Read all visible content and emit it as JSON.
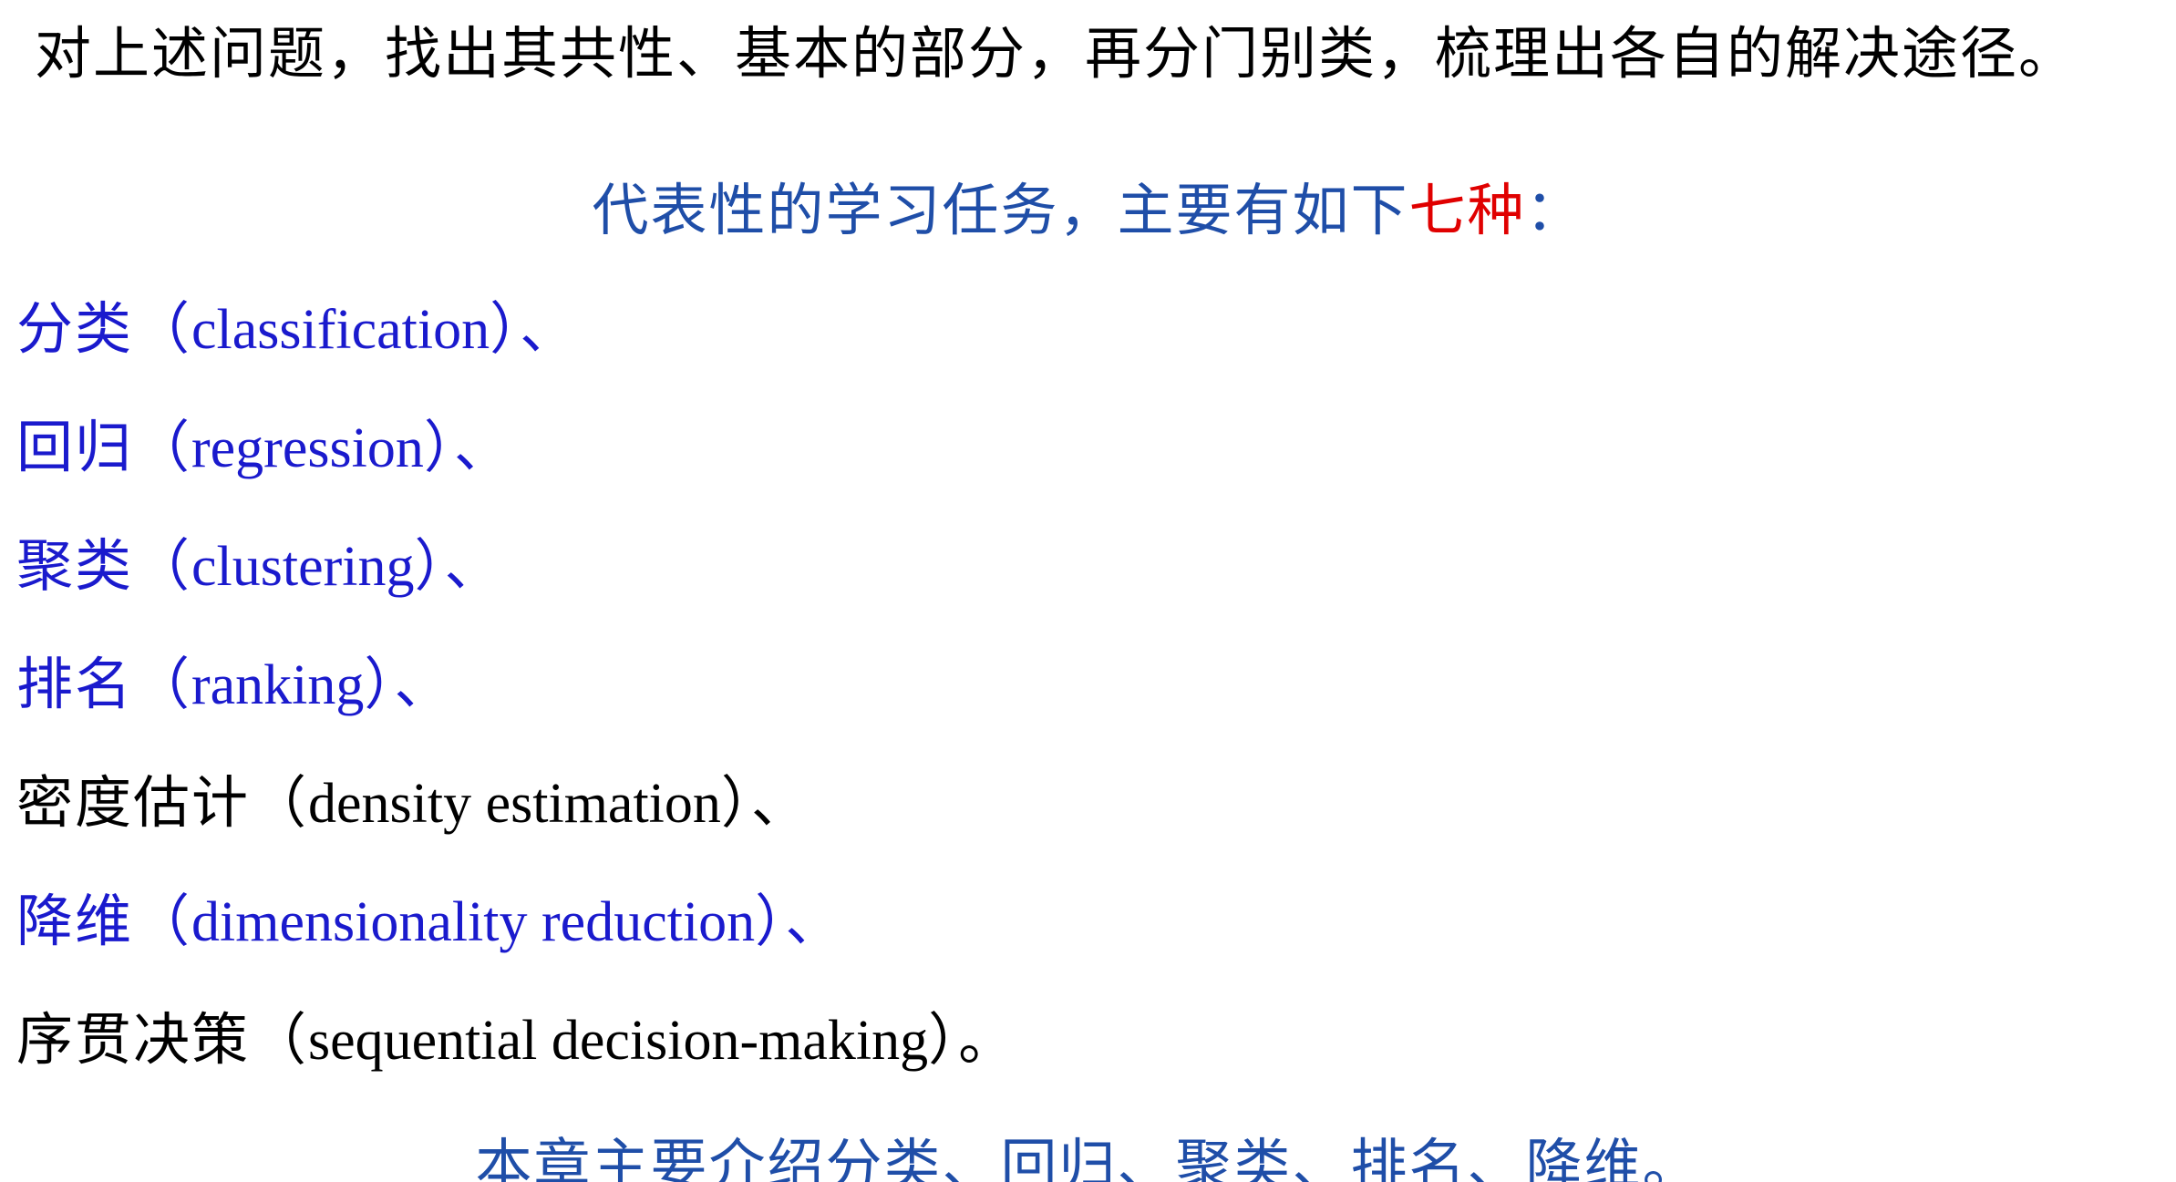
{
  "intro": "对上述问题，找出其共性、基本的部分，再分门别类，梳理出各自的解决途径。",
  "heading": {
    "before": "代表性的学习任务，主要有如下",
    "highlight": "七种",
    "after": "："
  },
  "items": [
    {
      "term": "分类（",
      "english": "classification",
      "close": "）",
      "sep": "、"
    },
    {
      "term": "回归（",
      "english": "regression",
      "close": "）",
      "sep": "、"
    },
    {
      "term": "聚类（",
      "english": "clustering",
      "close": "）",
      "sep": "、"
    },
    {
      "term": "排名（",
      "english": "ranking",
      "close": "）",
      "sep": "、"
    },
    {
      "term": "密度估计（",
      "english": "density estimation",
      "close": "）",
      "sep": "、"
    },
    {
      "term": "降维（",
      "english": "dimensionality reduction",
      "close": "）",
      "sep": "、"
    },
    {
      "term": "序贯决策（",
      "english": "sequential decision-making",
      "close": "）",
      "sep": "。"
    }
  ],
  "summary": "本章主要介绍分类、回归、聚类、排名、降维。",
  "colors": {
    "text": "#000000",
    "heading": "#1f4ea8",
    "highlight": "#e00000",
    "item_blue": "#1a1acd"
  }
}
